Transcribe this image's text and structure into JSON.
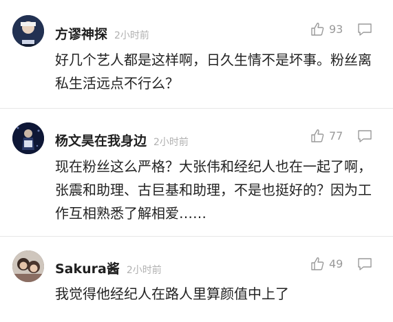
{
  "comments": [
    {
      "username": "方谬神探",
      "time": "2小时前",
      "likes": "93",
      "text": "好几个艺人都是这样啊，日久生情不是坏事。粉丝离私生活远点不行么？",
      "avatar_color": "#1d2b4a"
    },
    {
      "username": "杨文昊在我身边",
      "time": "2小时前",
      "likes": "77",
      "text": "现在粉丝这么严格？大张伟和经纪人也在一起了啊，张震和助理、古巨基和助理，不是也挺好的？因为工作互相熟悉了解相爱……",
      "avatar_color": "#0f1a3a"
    },
    {
      "username": "Sakura酱",
      "time": "2小时前",
      "likes": "49",
      "text": "我觉得他经纪人在路人里算颜值中上了",
      "avatar_color": "#5a4a44"
    }
  ]
}
